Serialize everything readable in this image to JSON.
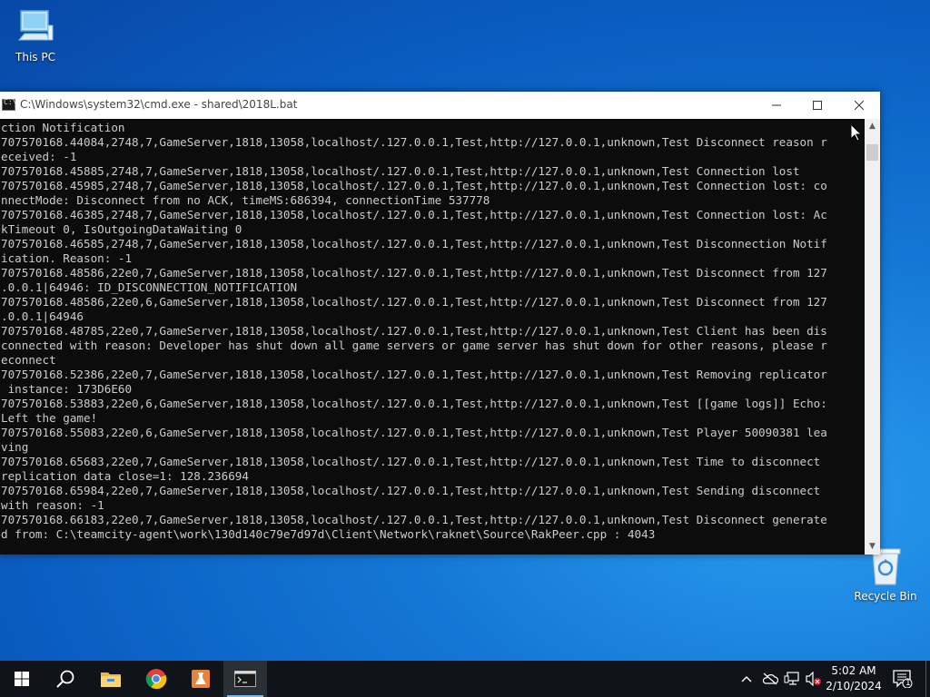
{
  "desktop": {
    "icons": [
      {
        "label": "This PC",
        "icon": "computer-icon"
      },
      {
        "label": "Recycle Bin",
        "icon": "recycle-bin-icon"
      }
    ]
  },
  "cmd_window": {
    "title": "C:\\Windows\\system32\\cmd.exe - shared\\2018L.bat",
    "icon_glyph": "C:\\",
    "controls": {
      "minimize": "—",
      "maximize": "☐",
      "close": "✕"
    },
    "lines": [
      "ction Notification",
      "707570168.44084,2748,7,GameServer,1818,13058,localhost/.127.0.0.1,Test,http://127.0.0.1,unknown,Test Disconnect reason r",
      "eceived: -1",
      "707570168.45885,2748,7,GameServer,1818,13058,localhost/.127.0.0.1,Test,http://127.0.0.1,unknown,Test Connection lost",
      "707570168.45985,2748,7,GameServer,1818,13058,localhost/.127.0.0.1,Test,http://127.0.0.1,unknown,Test Connection lost: co",
      "nnectMode: Disconnect from no ACK, timeMS:686394, connectionTime 537778",
      "707570168.46385,2748,7,GameServer,1818,13058,localhost/.127.0.0.1,Test,http://127.0.0.1,unknown,Test Connection lost: Ac",
      "kTimeout 0, IsOutgoingDataWaiting 0",
      "707570168.46585,2748,7,GameServer,1818,13058,localhost/.127.0.0.1,Test,http://127.0.0.1,unknown,Test Disconnection Notif",
      "ication. Reason: -1",
      "707570168.48586,22e0,7,GameServer,1818,13058,localhost/.127.0.0.1,Test,http://127.0.0.1,unknown,Test Disconnect from 127",
      ".0.0.1|64946: ID_DISCONNECTION_NOTIFICATION",
      "707570168.48586,22e0,6,GameServer,1818,13058,localhost/.127.0.0.1,Test,http://127.0.0.1,unknown,Test Disconnect from 127",
      ".0.0.1|64946",
      "707570168.48785,22e0,7,GameServer,1818,13058,localhost/.127.0.0.1,Test,http://127.0.0.1,unknown,Test Client has been dis",
      "connected with reason: Developer has shut down all game servers or game server has shut down for other reasons, please r",
      "econnect",
      "707570168.52386,22e0,7,GameServer,1818,13058,localhost/.127.0.0.1,Test,http://127.0.0.1,unknown,Test Removing replicator",
      " instance: 173D6E60",
      "707570168.53883,22e0,6,GameServer,1818,13058,localhost/.127.0.0.1,Test,http://127.0.0.1,unknown,Test [[game logs]] Echo:",
      "Left the game!",
      "707570168.55083,22e0,6,GameServer,1818,13058,localhost/.127.0.0.1,Test,http://127.0.0.1,unknown,Test Player 50090381 lea",
      "ving",
      "707570168.65683,22e0,7,GameServer,1818,13058,localhost/.127.0.0.1,Test,http://127.0.0.1,unknown,Test Time to disconnect ",
      "replication data close=1: 128.236694",
      "707570168.65984,22e0,7,GameServer,1818,13058,localhost/.127.0.0.1,Test,http://127.0.0.1,unknown,Test Sending disconnect ",
      "with reason: -1",
      "707570168.66183,22e0,7,GameServer,1818,13058,localhost/.127.0.0.1,Test,http://127.0.0.1,unknown,Test Disconnect generate",
      "d from: C:\\teamcity-agent\\work\\130d140c79e7d97d\\Client\\Network\\raknet\\Source\\RakPeer.cpp : 4043"
    ]
  },
  "taskbar": {
    "apps": [
      {
        "name": "start-button",
        "icon": "windows-logo-icon"
      },
      {
        "name": "search-button",
        "icon": "search-icon"
      },
      {
        "name": "file-explorer",
        "icon": "folder-icon"
      },
      {
        "name": "chrome",
        "icon": "chrome-icon"
      },
      {
        "name": "lab-app",
        "icon": "flask-icon"
      },
      {
        "name": "command-prompt",
        "icon": "terminal-icon"
      }
    ],
    "clock": {
      "time": "5:02 AM",
      "date": "2/10/2024"
    },
    "notification_count": "1",
    "tray_chevron": "^"
  },
  "colors": {
    "console_bg": "#0c0c0c",
    "console_text": "#cccccc",
    "taskbar_bg": "#101319",
    "active_indicator": "#76b9ed"
  }
}
